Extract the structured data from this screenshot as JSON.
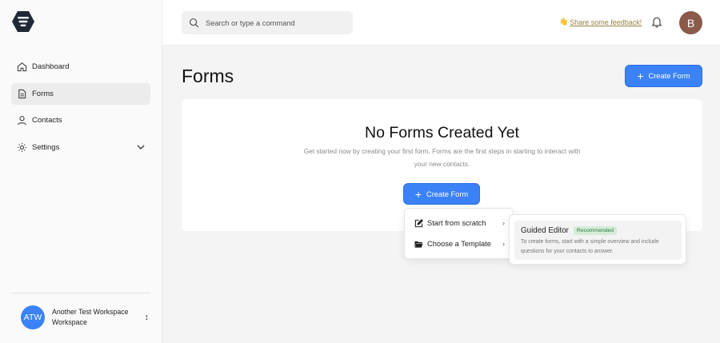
{
  "sidebar": {
    "items": [
      {
        "label": "Dashboard",
        "icon": "home-icon"
      },
      {
        "label": "Forms",
        "icon": "document-icon",
        "active": true
      },
      {
        "label": "Contacts",
        "icon": "user-icon"
      },
      {
        "label": "Settings",
        "icon": "gear-icon"
      }
    ],
    "workspace": {
      "initials": "ATW",
      "name": "Another Test Workspace",
      "type": "Workspace",
      "avatar_color": "#3b82f6"
    }
  },
  "topbar": {
    "search_placeholder": "Search or type a command",
    "feedback_emoji": "👋",
    "feedback_label": "Share some feedback!",
    "user_initial": "B"
  },
  "main": {
    "title": "Forms",
    "create_button": "Create Form",
    "empty_title": "No Forms Created Yet",
    "empty_description": "Get started now by creating your first form. Forms are the first steps in starting to interact with your new contacts.",
    "empty_create_button": "Create Form"
  },
  "menu": {
    "items": [
      {
        "label": "Start from scratch",
        "icon": "edit-icon"
      },
      {
        "label": "Choose a Template",
        "icon": "folder-icon"
      }
    ],
    "submenu": {
      "title": "Guided Editor",
      "badge": "Recommended",
      "description": "To create forms, start with a simple overview and include questions for your contacts to answer."
    }
  },
  "colors": {
    "primary": "#3b82f6",
    "badge_bg": "#d5ecd9",
    "badge_text": "#2e7d40"
  }
}
